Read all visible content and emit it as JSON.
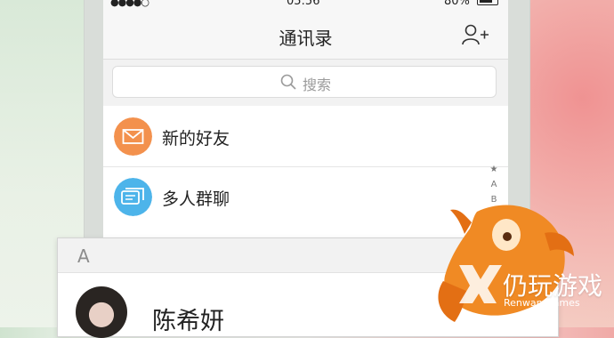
{
  "status_bar": {
    "signal": "●●●●○",
    "time": "05:56",
    "battery": "80%"
  },
  "navbar": {
    "title": "通讯录",
    "add_friend_icon": "add-friend-icon"
  },
  "search": {
    "placeholder": "搜索",
    "icon": "search-icon"
  },
  "list": [
    {
      "label": "新的好友",
      "icon": "mail-icon",
      "color": "#F3914D"
    },
    {
      "label": "多人群聊",
      "icon": "chat-icon",
      "color": "#4DB4EA"
    }
  ],
  "index_bar": [
    "★",
    "A",
    "B"
  ],
  "contacts": {
    "section_letter": "A",
    "rows": [
      {
        "name": "陈希妍"
      }
    ]
  },
  "watermark": {
    "cn": "仍玩游戏",
    "en": "Renwan Games"
  },
  "colors": {
    "mascot_orange": "#F08A24",
    "accent_blue": "#4DB4EA"
  }
}
